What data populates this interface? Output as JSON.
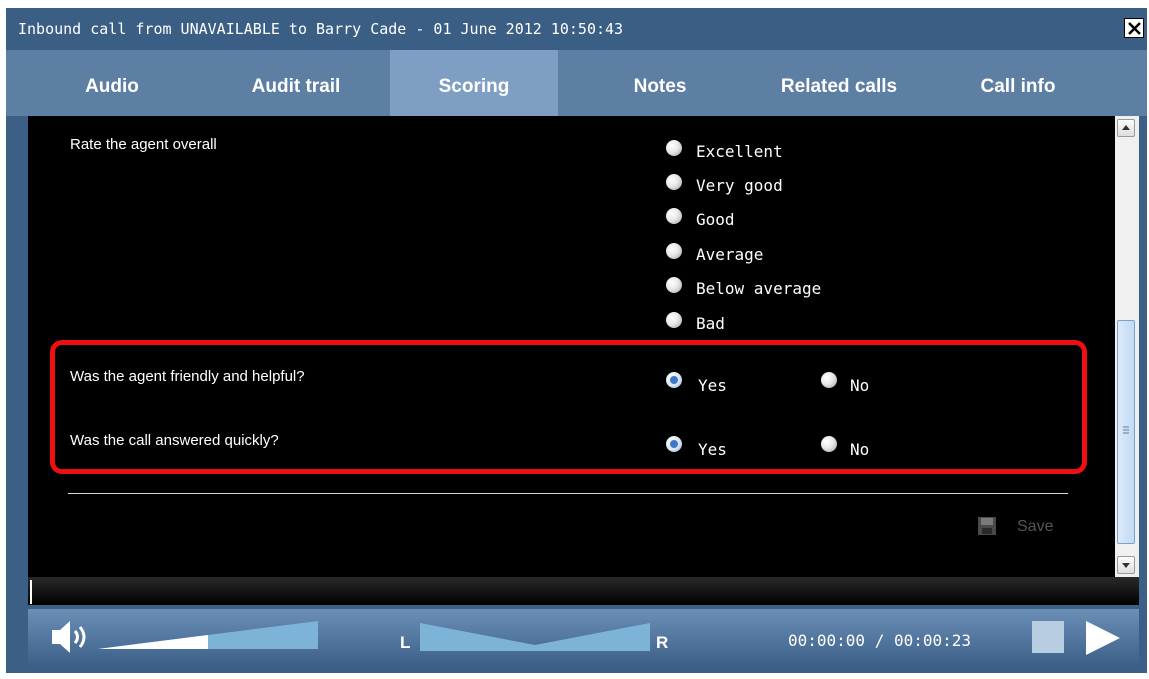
{
  "window": {
    "title": "Inbound call from UNAVAILABLE to Barry Cade - 01 June 2012 10:50:43",
    "close_icon": "close-icon"
  },
  "tabs": [
    {
      "label": "Audio",
      "active": false
    },
    {
      "label": "Audit trail",
      "active": false
    },
    {
      "label": "Scoring",
      "active": true
    },
    {
      "label": "Notes",
      "active": false
    },
    {
      "label": "Related calls",
      "active": false
    },
    {
      "label": "Call info",
      "active": false
    }
  ],
  "scoring": {
    "overall": {
      "question": "Rate the agent overall",
      "options": [
        "Excellent",
        "Very good",
        "Good",
        "Average",
        "Below average",
        "Bad"
      ],
      "selected": null
    },
    "questions": [
      {
        "question": "Was the agent friendly and helpful?",
        "yes": "Yes",
        "no": "No",
        "selected": "Yes"
      },
      {
        "question": "Was the call answered quickly?",
        "yes": "Yes",
        "no": "No",
        "selected": "Yes"
      }
    ],
    "save_label": "Save",
    "save_enabled": false,
    "highlight_color": "#ee1010"
  },
  "player": {
    "time": "00:00:00 / 00:00:23",
    "balance_left": "L",
    "balance_right": "R",
    "volume_level": 0.5,
    "balance_level": 0.5,
    "progress_level": 0.0
  }
}
